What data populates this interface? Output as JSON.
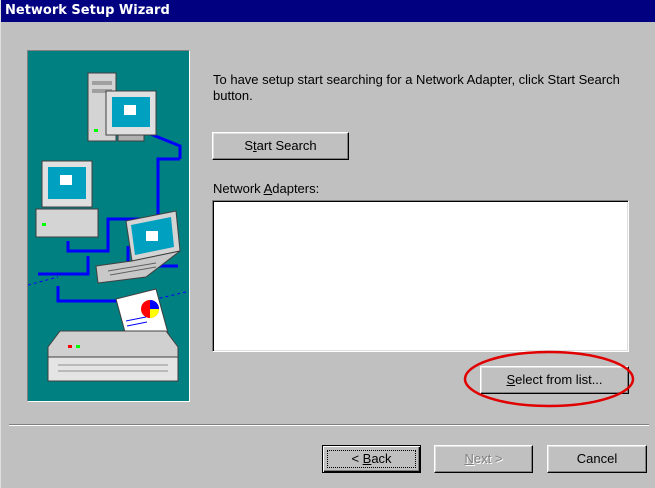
{
  "window": {
    "title": "Network Setup Wizard"
  },
  "content": {
    "instruction": "To have setup start searching for a Network Adapter, click Start Search button.",
    "start_search": {
      "pre": "S",
      "ul": "t",
      "post": "art Search"
    },
    "adapters_label": {
      "pre": "Network ",
      "ul": "A",
      "post": "dapters:"
    },
    "adapters_list": [],
    "select_from_list": {
      "pre": "",
      "ul": "S",
      "post": "elect from list..."
    }
  },
  "footer": {
    "back": {
      "pre": "< ",
      "ul": "B",
      "post": "ack"
    },
    "next": {
      "pre": "",
      "ul": "N",
      "post": "ext >"
    },
    "cancel": {
      "pre": "Cancel",
      "ul": "",
      "post": ""
    }
  },
  "annotation": {
    "color": "#e00000"
  },
  "colors": {
    "titlebar": "#000080",
    "panel": "#c0c0c0",
    "art_bg": "#008080"
  },
  "icons": [
    "computer-tower-icon",
    "desktop-computer-icon",
    "laptop-icon",
    "printer-icon"
  ]
}
